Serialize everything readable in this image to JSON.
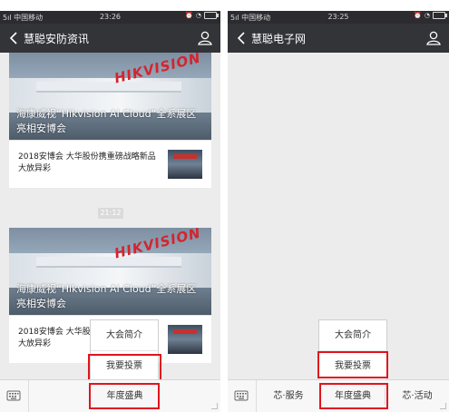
{
  "left_phone": {
    "status": {
      "carrier": "5ıl 中国移动 ",
      "time": "23:26"
    },
    "title": "慧聪安防资讯",
    "timestamp": "21:12",
    "articles": [
      {
        "caption": "海康威视“Hikvision AI Cloud”全系展区亮相安博会",
        "brand": "HIKVISION",
        "item_text": "2018安博会 大华股份携重磅战略新品大放异彩"
      },
      {
        "caption": "海康威视“Hikvision AI Cloud”全系展区亮相安博会",
        "brand": "HIKVISION",
        "item_text": "2018安博会 大华股份携重磅战略新品大放异彩"
      }
    ],
    "menu": {
      "main_label": "年度盛典",
      "popup_items": [
        "大会简介",
        "我要投票"
      ]
    }
  },
  "right_phone": {
    "status": {
      "carrier": "5ıl 中国移动 ",
      "time": "23:25"
    },
    "title": "慧聪电子网",
    "menu": {
      "left_label": "芯·服务",
      "main_label": "年度盛典",
      "right_label": "芯·活动",
      "popup_items": [
        "大会简介",
        "我要投票"
      ]
    }
  },
  "colors": {
    "highlight": "#e0151e",
    "navbar": "#333438",
    "chat_bg": "#ececec"
  },
  "icons": [
    "back-arrow-icon",
    "profile-icon",
    "keyboard-icon",
    "wifi-icon",
    "battery-icon"
  ]
}
